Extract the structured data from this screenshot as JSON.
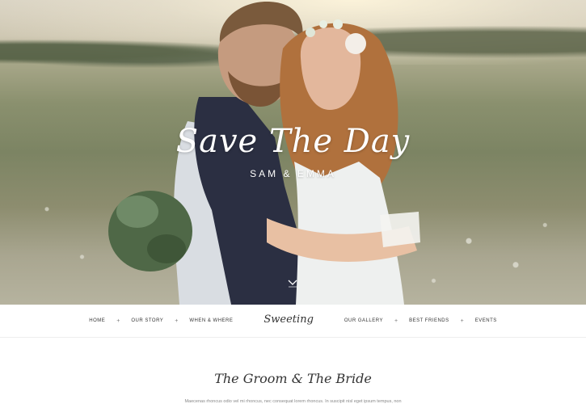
{
  "hero": {
    "title": "Save The Day",
    "subtitle": "SAM & EMMA"
  },
  "nav": {
    "left_items": [
      "HOME",
      "OUR STORY",
      "WHEN & WHERE"
    ],
    "logo": "Sweeting",
    "right_items": [
      "OUR GALLERY",
      "BEST FRIENDS",
      "EVENTS"
    ],
    "separator": "+"
  },
  "section": {
    "title": "The Groom & The Bride",
    "text": "Maecenas rhoncus odio vel mi rhoncus, nec consequat lorem rhoncus. In suscipit nisl eget ipsum tempus, non"
  },
  "icons": {
    "scroll": "chevron-down-icon"
  }
}
